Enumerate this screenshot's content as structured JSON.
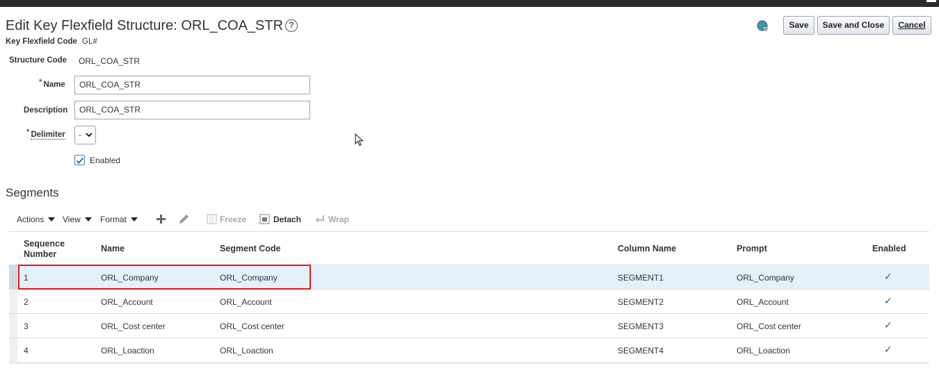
{
  "header": {
    "title": "Edit Key Flexfield Structure: ORL_COA_STR",
    "help": "?"
  },
  "buttons": {
    "save": "Save",
    "save_close": "Save and Close",
    "cancel": "Cancel"
  },
  "form": {
    "kf_code_label": "Key Flexfield Code",
    "kf_code_value": "GL#",
    "structure_code_label": "Structure Code",
    "structure_code_value": "ORL_COA_STR",
    "name_label": "Name",
    "name_value": "ORL_COA_STR",
    "description_label": "Description",
    "description_value": "ORL_COA_STR",
    "delimiter_label": "Delimiter",
    "delimiter_value": "-",
    "enabled_label": "Enabled",
    "enabled_checked": true,
    "required_mark": "*"
  },
  "segments": {
    "title": "Segments",
    "toolbar": {
      "actions": "Actions",
      "view": "View",
      "format": "Format",
      "freeze": "Freeze",
      "detach": "Detach",
      "wrap": "Wrap"
    },
    "columns": {
      "seq_line1": "Sequence",
      "seq_line2": "Number",
      "name": "Name",
      "segment_code": "Segment Code",
      "column_name": "Column Name",
      "prompt": "Prompt",
      "enabled": "Enabled"
    },
    "rows": [
      {
        "seq": "1",
        "name": "ORL_Company",
        "code": "ORL_Company",
        "column": "SEGMENT1",
        "prompt": "ORL_Company",
        "enabled": "✓"
      },
      {
        "seq": "2",
        "name": "ORL_Account",
        "code": "ORL_Account",
        "column": "SEGMENT2",
        "prompt": "ORL_Account",
        "enabled": "✓"
      },
      {
        "seq": "3",
        "name": "ORL_Cost center",
        "code": "ORL_Cost center",
        "column": "SEGMENT3",
        "prompt": "ORL_Cost center",
        "enabled": "✓"
      },
      {
        "seq": "4",
        "name": "ORL_Loaction",
        "code": "ORL_Loaction",
        "column": "SEGMENT4",
        "prompt": "ORL_Loaction",
        "enabled": "✓"
      }
    ]
  },
  "colors": {
    "selected_row": "#e4f0fa",
    "highlight": "#e01818",
    "required": "#1a6fb3"
  }
}
